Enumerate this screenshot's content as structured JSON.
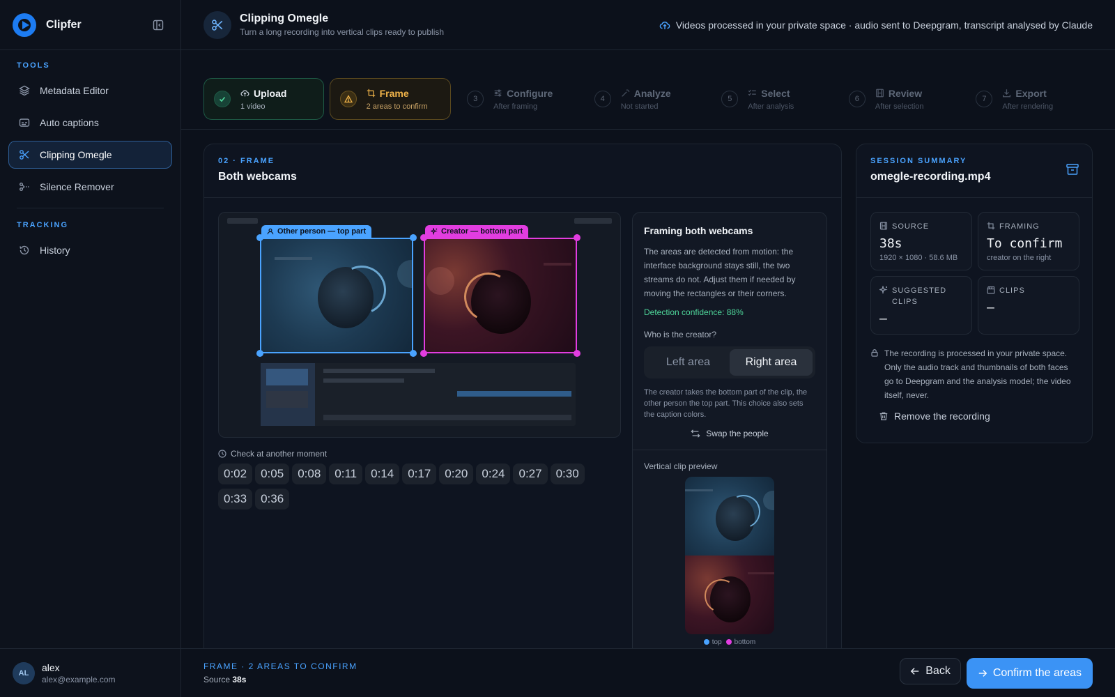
{
  "app": {
    "name": "Clipfer"
  },
  "sidebar": {
    "sections": [
      {
        "title": "TOOLS",
        "items": [
          {
            "label": "Metadata Editor",
            "icon": "layers-icon"
          },
          {
            "label": "Auto captions",
            "icon": "captions-icon"
          },
          {
            "label": "Clipping Omegle",
            "icon": "scissors-icon",
            "active": true
          },
          {
            "label": "Silence Remover",
            "icon": "scissors-dashed-icon"
          }
        ]
      },
      {
        "title": "TRACKING",
        "items": [
          {
            "label": "History",
            "icon": "history-icon"
          }
        ]
      }
    ],
    "user": {
      "initials": "AL",
      "name": "alex",
      "email": "alex@example.com"
    }
  },
  "header": {
    "title": "Clipping Omegle",
    "subtitle": "Turn a long recording into vertical clips ready to publish",
    "note": "Videos processed in your private space · audio sent to Deepgram, transcript analysed by Claude"
  },
  "steps": [
    {
      "num": "1",
      "label": "Upload",
      "sub": "1 video",
      "state": "done"
    },
    {
      "num": "2",
      "label": "Frame",
      "sub": "2 areas to confirm",
      "state": "warn"
    },
    {
      "num": "3",
      "label": "Configure",
      "sub": "After framing",
      "state": "idle"
    },
    {
      "num": "4",
      "label": "Analyze",
      "sub": "Not started",
      "state": "idle"
    },
    {
      "num": "5",
      "label": "Select",
      "sub": "After analysis",
      "state": "idle"
    },
    {
      "num": "6",
      "label": "Review",
      "sub": "After selection",
      "state": "idle"
    },
    {
      "num": "7",
      "label": "Export",
      "sub": "After rendering",
      "state": "idle"
    }
  ],
  "frame": {
    "eyebrow": "02 · FRAME",
    "title": "Both webcams",
    "tag_other": "Other person — top part",
    "tag_creator": "Creator — bottom part",
    "moments_label": "Check at another moment",
    "moments": [
      "0:02",
      "0:05",
      "0:08",
      "0:11",
      "0:14",
      "0:17",
      "0:20",
      "0:24",
      "0:27",
      "0:30",
      "0:33",
      "0:36"
    ],
    "side": {
      "title": "Framing both webcams",
      "desc": "The areas are detected from motion: the interface background stays still, the two streams do not. Adjust them if needed by moving the rectangles or their corners.",
      "confidence": "Detection confidence: 88%",
      "question": "Who is the creator?",
      "option_left": "Left area",
      "option_right": "Right area",
      "selected": "right",
      "note": "The creator takes the bottom part of the clip, the other person the top part. This choice also sets the caption colors.",
      "swap": "Swap the people",
      "preview_label": "Vertical clip preview",
      "legend_top": "top",
      "legend_bottom": "bottom"
    }
  },
  "summary": {
    "eyebrow": "SESSION SUMMARY",
    "filename": "omegle-recording.mp4",
    "tiles": {
      "source": {
        "label": "SOURCE",
        "value": "38s",
        "sub": "1920 × 1080 · 58.6 MB"
      },
      "framing": {
        "label": "FRAMING",
        "value": "To confirm",
        "sub": "creator on the right"
      },
      "suggested": {
        "label": "SUGGESTED CLIPS",
        "value": "—"
      },
      "clips": {
        "label": "CLIPS",
        "value": "—"
      }
    },
    "privacy": "The recording is processed in your private space. Only the audio track and thumbnails of both faces go to Deepgram and the analysis model; the video itself, never.",
    "remove": "Remove the recording"
  },
  "footer": {
    "status": "FRAME · 2 AREAS TO CONFIRM",
    "source_prefix": "Source",
    "source_value": "38s",
    "back": "Back",
    "confirm": "Confirm the areas"
  },
  "colors": {
    "accent": "#4aa3ff",
    "other_person": "#4aa3ff",
    "creator": "#e23de0",
    "success": "#4fd79b",
    "warning": "#f2b54a"
  }
}
